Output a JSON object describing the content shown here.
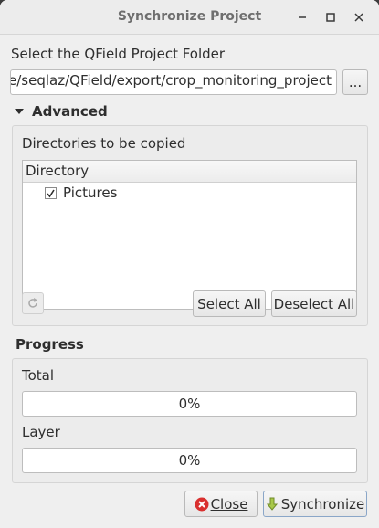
{
  "window": {
    "title": "Synchronize Project"
  },
  "project": {
    "label": "Select the QField Project Folder",
    "path": "e/seqlaz/QField/export/crop_monitoring_project",
    "browse_label": "..."
  },
  "advanced": {
    "header": "Advanced",
    "directories_label": "Directories to be copied",
    "column_header": "Directory",
    "directories": [
      {
        "name": "Pictures",
        "checked": true
      }
    ],
    "select_all": "Select All",
    "deselect_all": "Deselect All"
  },
  "progress": {
    "header": "Progress",
    "total_label": "Total",
    "total_text": "0%",
    "total_value": 0,
    "layer_label": "Layer",
    "layer_text": "0%",
    "layer_value": 0
  },
  "buttons": {
    "close": "Close",
    "synchronize": "Synchronize"
  },
  "icons": {
    "minimize": "minimize-icon",
    "maximize": "maximize-icon",
    "close": "close-icon",
    "collapse": "triangle-down-icon",
    "refresh": "refresh-icon",
    "close_button": "red-x-icon",
    "sync_button": "download-arrow-icon"
  },
  "colors": {
    "close_icon_bg": "#d9302f",
    "sync_icon": "#a8c84a"
  }
}
